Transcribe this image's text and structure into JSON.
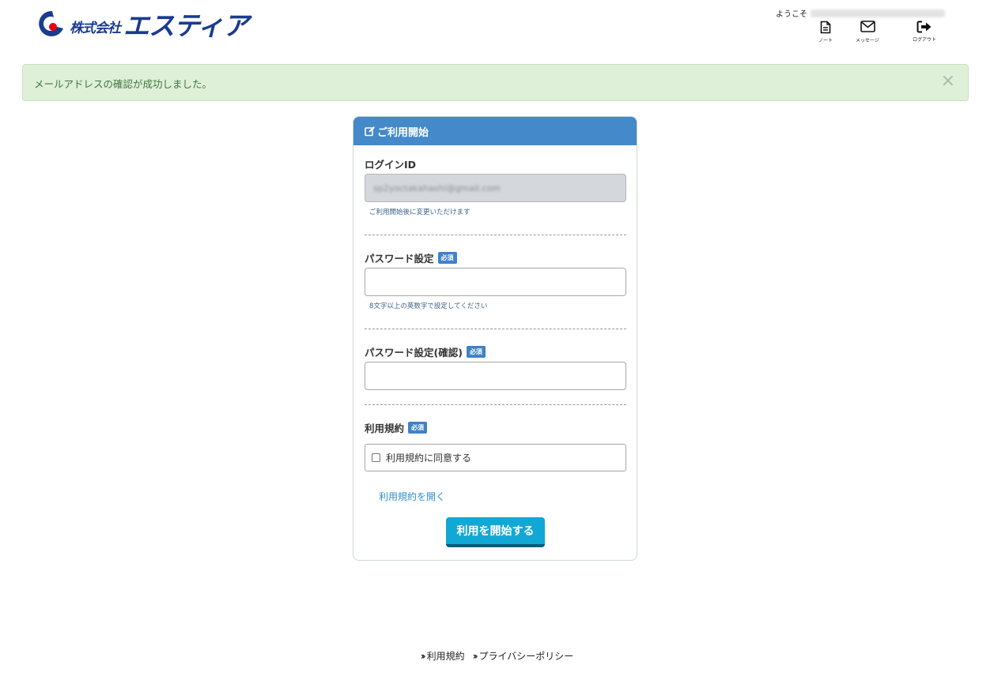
{
  "header": {
    "logo_company": "株式会社",
    "logo_name": "エスティア",
    "welcome_label": "ようこそ",
    "icons": [
      {
        "label": "ノート",
        "icon": "document-icon"
      },
      {
        "label": "メッセージ",
        "icon": "envelope-icon"
      },
      {
        "label": "ログアウト",
        "icon": "sign-out-icon"
      }
    ]
  },
  "alert": {
    "message": "メールアドレスの確認が成功しました。",
    "close": "×"
  },
  "form": {
    "title": "ご利用開始",
    "login_id": {
      "label": "ログインID",
      "value": "sp2yoctakahashi@gmail.com",
      "hint": "ご利用開始後に変更いただけます"
    },
    "password": {
      "label": "パスワード設定",
      "required": "必須",
      "value": "",
      "hint": "8文字以上の英数字で設定してください"
    },
    "password_confirm": {
      "label": "パスワード設定(確認)",
      "required": "必須",
      "value": ""
    },
    "terms": {
      "label": "利用規約",
      "required": "必須",
      "agree_label": "利用規約に同意する",
      "agree_checked": false,
      "open_link": "利用規約を開く"
    },
    "submit_label": "利用を開始する"
  },
  "footer": {
    "links": [
      {
        "label": "利用規約"
      },
      {
        "label": "プライバシーポリシー"
      }
    ]
  },
  "colors": {
    "brand_blue": "#1a3c8f",
    "card_header": "#4489c9",
    "button": "#11a8d6",
    "alert_bg": "#dff0d8",
    "alert_text": "#3c763d"
  }
}
